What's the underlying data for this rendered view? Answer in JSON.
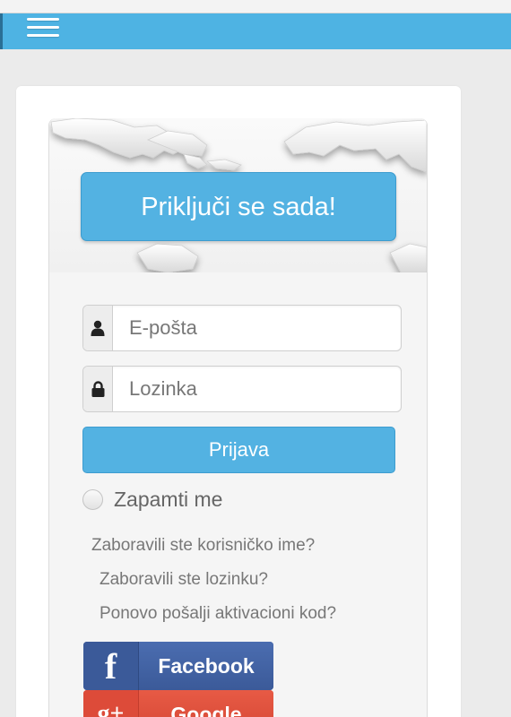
{
  "header": {
    "menu_icon": "hamburger-menu-icon",
    "accent_color": "#4eb3e3"
  },
  "hero": {
    "join_label": "Priključi se sada!"
  },
  "form": {
    "email_placeholder": "E-pošta",
    "email_icon": "user-icon",
    "password_placeholder": "Lozinka",
    "password_icon": "lock-icon",
    "login_label": "Prijava",
    "remember_label": "Zapamti me"
  },
  "links": {
    "forgot_username": "Zaboravili ste korisničko ime?",
    "forgot_password": "Zaboravili ste lozinku?",
    "resend_activation": "Ponovo pošalji aktivacioni kod?"
  },
  "social": {
    "facebook_icon_glyph": "f",
    "facebook_label": "Facebook",
    "facebook_color": "#3b5a99",
    "google_icon_glyph": "g+",
    "google_label": "Google",
    "google_color": "#dd4b39"
  }
}
